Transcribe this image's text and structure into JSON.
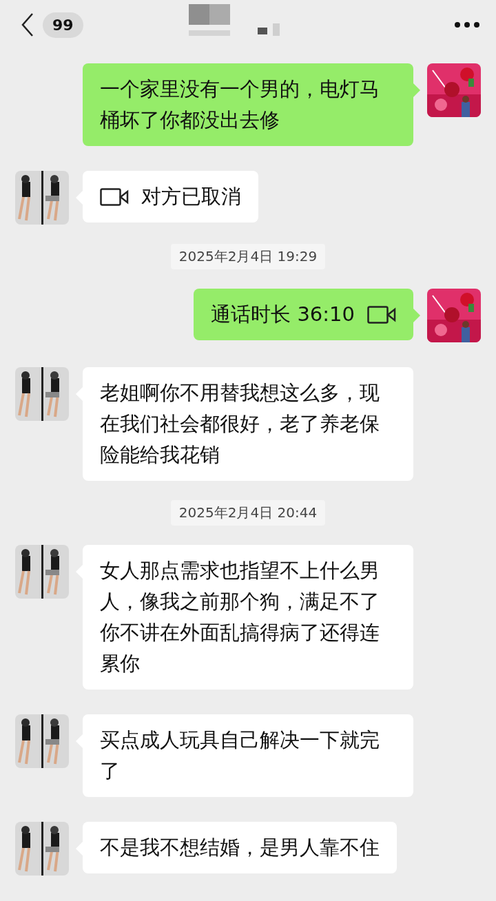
{
  "header": {
    "back_count": "99"
  },
  "messages": [
    {
      "kind": "text",
      "outgoing": true,
      "text": "一个家里没有一个男的，电灯马桶坏了你都没出去修"
    },
    {
      "kind": "call",
      "outgoing": false,
      "text": "对方已取消"
    },
    {
      "kind": "time",
      "text": "2025年2月4日 19:29"
    },
    {
      "kind": "call",
      "outgoing": true,
      "text": "通话时长 36:10"
    },
    {
      "kind": "text",
      "outgoing": false,
      "text": "老姐啊你不用替我想这么多，现在我们社会都很好，老了养老保险能给我花销"
    },
    {
      "kind": "time",
      "text": "2025年2月4日 20:44"
    },
    {
      "kind": "text",
      "outgoing": false,
      "text": "女人那点需求也指望不上什么男人，像我之前那个狗，满足不了你不讲在外面乱搞得病了还得连累你"
    },
    {
      "kind": "text",
      "outgoing": false,
      "text": "买点成人玩具自己解决一下就完了"
    },
    {
      "kind": "text",
      "outgoing": false,
      "text": "不是我不想结婚，是男人靠不住"
    }
  ]
}
